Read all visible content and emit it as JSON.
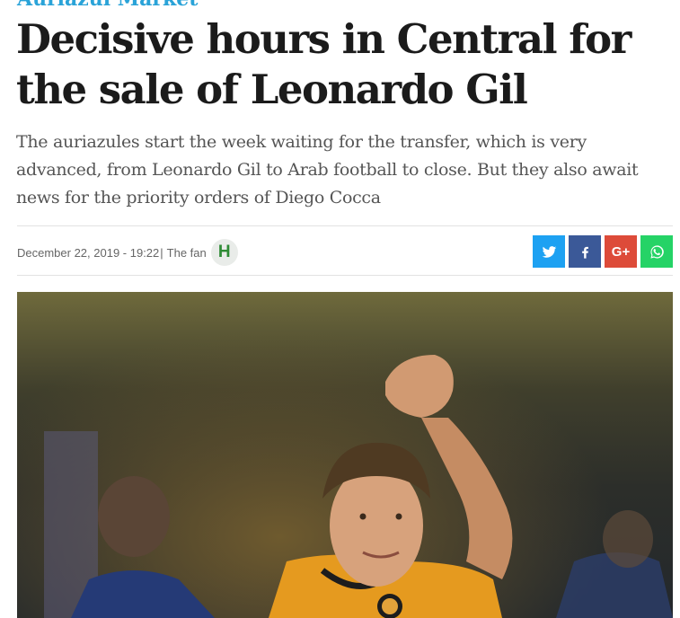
{
  "section": "Auriazul Market",
  "headline": "Decisive hours in Central for the sale of Leonardo Gil",
  "summary": "The auriazules start the week waiting for the transfer, which is very advanced, from Leonardo Gil to Arab football to close. But they also await news for the priority orders of Diego Cocca",
  "meta": {
    "date": "December 22, 2019 - 19:22",
    "separator": "|",
    "author": "The fan",
    "author_logo_letter": "H"
  },
  "share": {
    "twitter": "twitter-icon",
    "facebook": "facebook-icon",
    "google_plus_label": "G+",
    "whatsapp": "whatsapp-icon"
  },
  "colors": {
    "section": "#2aa3d8",
    "twitter": "#1da1f2",
    "facebook": "#3b5998",
    "google_plus": "#dd4b39",
    "whatsapp": "#25d366"
  }
}
